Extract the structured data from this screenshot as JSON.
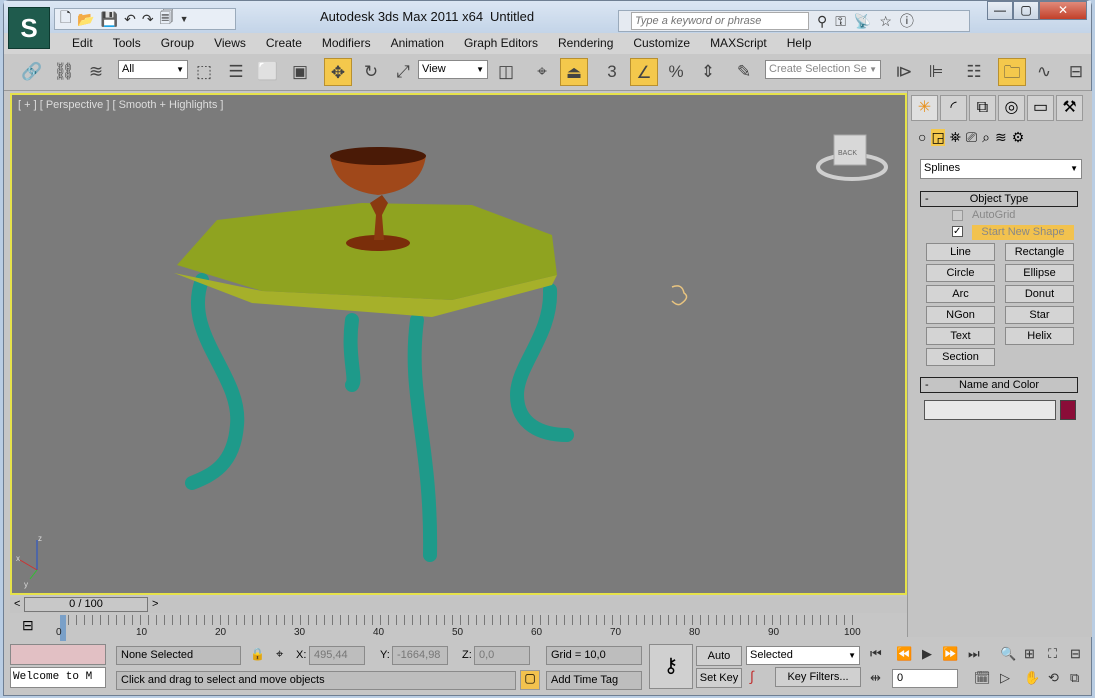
{
  "title": {
    "app": "Autodesk 3ds Max  2011 x64",
    "document": "Untitled",
    "logo": "3ds Max logo"
  },
  "search": {
    "placeholder": "Type a keyword or phrase"
  },
  "window_controls": {
    "minimize": "—",
    "maximize": "▢",
    "close": "✕"
  },
  "menu": [
    "Edit",
    "Tools",
    "Group",
    "Views",
    "Create",
    "Modifiers",
    "Animation",
    "Graph Editors",
    "Rendering",
    "Customize",
    "MAXScript",
    "Help"
  ],
  "toolbar": {
    "selection_filter": "All",
    "reference_coord": "View",
    "snap_value": "3",
    "named_selection_placeholder": "Create Selection Se"
  },
  "viewport": {
    "label": "[ + ] [ Perspective ] [ Smooth + Highlights ]",
    "viewcube_label": "BACK",
    "axis": {
      "x": "x",
      "y": "y",
      "z": "z"
    }
  },
  "command_panel": {
    "category": "Splines",
    "object_type": {
      "header": "Object Type",
      "collapse": "-",
      "autogrid": "AutoGrid",
      "autogrid_checked": false,
      "start_new_shape": "Start New Shape",
      "start_new_shape_checked": true,
      "buttons": [
        "Line",
        "Rectangle",
        "Circle",
        "Ellipse",
        "Arc",
        "Donut",
        "NGon",
        "Star",
        "Text",
        "Helix",
        "Section"
      ]
    },
    "name_color": {
      "header": "Name and Color",
      "collapse": "-",
      "name_value": "",
      "color": "#8b0d38"
    }
  },
  "timeline": {
    "slider": "0 / 100",
    "prev": "<",
    "next": ">",
    "ticks": [
      "0",
      "10",
      "20",
      "30",
      "40",
      "50",
      "60",
      "70",
      "80",
      "90",
      "100"
    ]
  },
  "status": {
    "maxscript_listener": "Welcome to M",
    "selection": "None Selected",
    "prompt": "Click and drag to select and move objects",
    "x_label": "X:",
    "x": "495,44",
    "y_label": "Y:",
    "y": "-1664,98",
    "z_label": "Z:",
    "z": "0,0",
    "grid": "Grid = 10,0",
    "add_time_tag": "Add Time Tag"
  },
  "animation": {
    "auto_key": "Auto Key",
    "set_key": "Set Key",
    "key_mode": "Selected",
    "key_filters": "Key Filters...",
    "current_frame": "0"
  }
}
